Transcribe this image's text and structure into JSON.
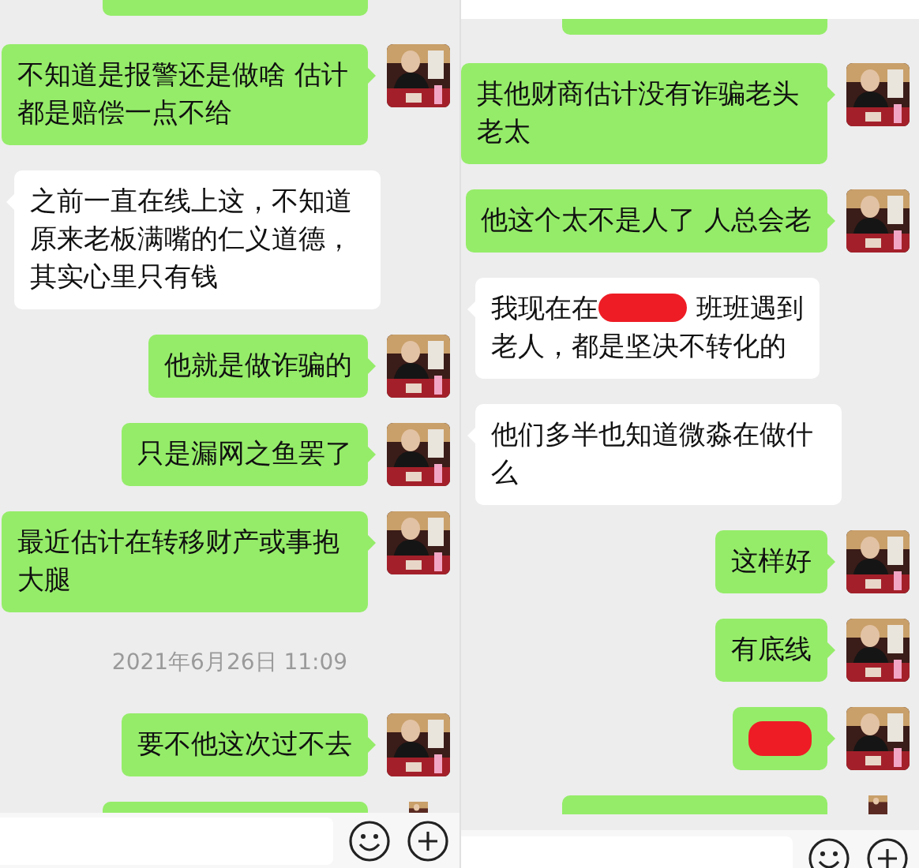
{
  "panels": [
    {
      "messages": [
        {
          "kind": "cut"
        },
        {
          "kind": "sent",
          "text": "不知道是报警还是做啥 估计都是赔偿一点不给"
        },
        {
          "kind": "received",
          "text": "之前一直在线上这，不知道原来老板满嘴的仁义道德，其实心里只有钱"
        },
        {
          "kind": "sent",
          "text": "他就是做诈骗的"
        },
        {
          "kind": "sent",
          "text": "只是漏网之鱼罢了"
        },
        {
          "kind": "sent",
          "text": "最近估计在转移财产或事抱大腿"
        },
        {
          "kind": "time",
          "text": "2021年6月26日 11:09"
        },
        {
          "kind": "sent",
          "text": "要不他这次过不去"
        },
        {
          "kind": "cut"
        }
      ]
    },
    {
      "messages": [
        {
          "kind": "cut"
        },
        {
          "kind": "sent",
          "text": "其他财商估计没有诈骗老头老太"
        },
        {
          "kind": "sent",
          "text": "他这个太不是人了 人总会老"
        },
        {
          "kind": "received",
          "parts": [
            {
              "text": "我现在在"
            },
            {
              "kind": "redaction"
            },
            {
              "text": "班班遇到"
            },
            {
              "text": "老人，都是坚决不转化的",
              "kind": "line"
            }
          ]
        },
        {
          "kind": "received",
          "text": "他们多半也知道微淼在做什么"
        },
        {
          "kind": "sent",
          "text": "这样好"
        },
        {
          "kind": "sent",
          "text": "有底线"
        },
        {
          "kind": "sent",
          "parts": [
            {
              "kind": "redaction"
            }
          ]
        },
        {
          "kind": "cut"
        }
      ]
    }
  ]
}
